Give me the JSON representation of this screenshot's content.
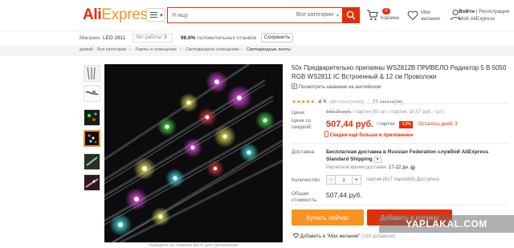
{
  "header": {
    "logo_ali": "Ali",
    "logo_express": "Express",
    "search_placeholder": "Я ищу",
    "category": "Все категории",
    "cart_count": "0",
    "cart_label": "Корзина",
    "wish_label": "Мои желания",
    "login_text": "Войти",
    "register_text": "Регистрация",
    "my_ali": "Мой AliExpress"
  },
  "store": {
    "label": "Магазин:",
    "name": "LED 2811",
    "years_label": "Лет работы:",
    "years_value": "3",
    "feedback_value": "98.6%",
    "feedback_label": "положительных отзывов",
    "save_button": "Сохранить"
  },
  "breadcrumbs": [
    "домой",
    "Все категории",
    "Лампы и освещение",
    "Светодиодное освещение",
    "Светодиодные ленты"
  ],
  "product": {
    "title": "50x Предварительно припаяны WS2812B ПРИВЕЛО Радиатор 5 В 5050 RGB WS2811 IC Встроенный & 12 см Проволоки",
    "translate": "Посмотреть название на английском",
    "rating_score": "4.9",
    "rating_votes": "(48 голос(а/ов))",
    "orders": "72 заказа(ов)",
    "price_label": "Цена:",
    "old_price": "583,25 руб.",
    "old_price_suffix": "/ партия (50 шт. / партия, 10,57 руб. / шт.)",
    "discount_label": "Цена со скидкой:",
    "new_price": "507,44 руб.",
    "per_lot": "/ партия",
    "discount": "-13%",
    "time_left": "Осталось дней: 3",
    "app_price": "Скидки ещё больше в приложении",
    "delivery_label": "Доставка:",
    "delivery": "Бесплатная доставка в Russian Federation службой AliExpress Standard Shipping",
    "delivery_est_label": "Расчетное время доставки:",
    "delivery_est_value": "17-22 дн.",
    "qty_label": "Количество:",
    "qty_value": "1",
    "qty_note": "партия (617 партий(й) Доступно)",
    "total_label": "Общая стоимость:",
    "total_value": "507,44 руб.",
    "buy_now": "Купить сейчас",
    "add_to_cart": "Добавить в корзину",
    "wish_add": "Добавить в \"Мои желания\"",
    "wish_count": "(189 добавили)",
    "photo_caption": "Наведите на главное фото для увеличения"
  },
  "watermark": "YAPLAKAL.COM"
}
